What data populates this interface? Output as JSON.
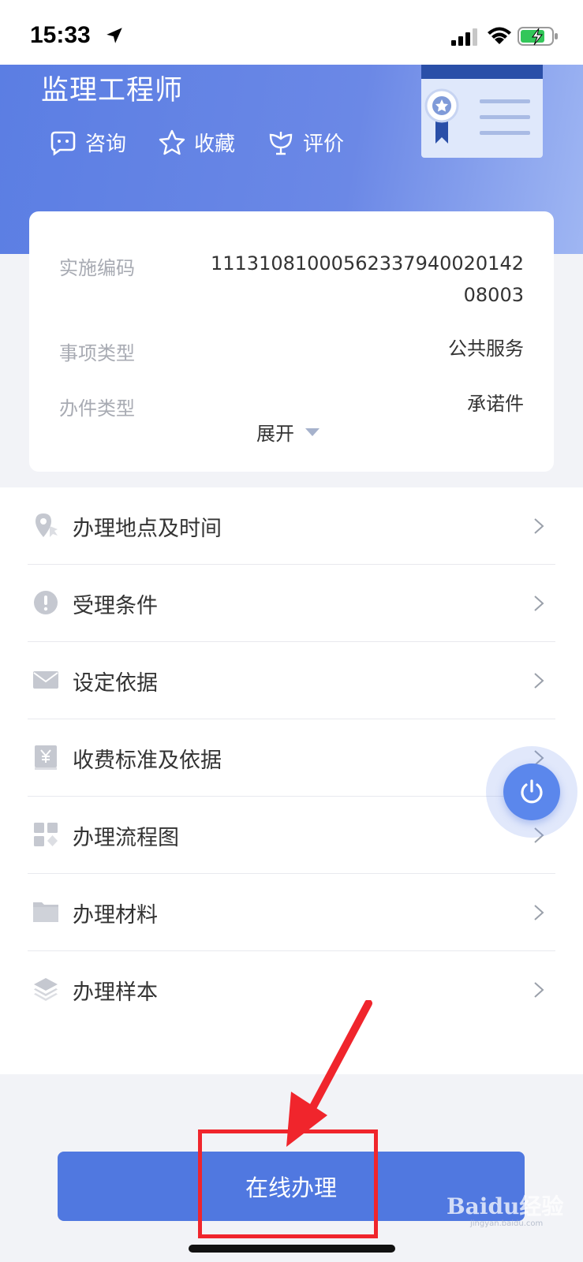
{
  "status_bar": {
    "time": "15:33"
  },
  "hero": {
    "title": "监理工程师",
    "actions": [
      {
        "label": "咨询",
        "icon": "chat-icon"
      },
      {
        "label": "收藏",
        "icon": "star-icon"
      },
      {
        "label": "评价",
        "icon": "rate-icon"
      }
    ]
  },
  "info": {
    "rows": [
      {
        "label": "实施编码",
        "value_line1": "11131081000562337940020142",
        "value_line2": "08003"
      },
      {
        "label": "事项类型",
        "value_line1": "公共服务"
      },
      {
        "label": "办件类型",
        "value_line1": "承诺件"
      }
    ],
    "expand_label": "展开"
  },
  "menu": {
    "items": [
      {
        "label": "办理地点及时间",
        "icon": "location-icon"
      },
      {
        "label": "受理条件",
        "icon": "alert-icon"
      },
      {
        "label": "设定依据",
        "icon": "mail-icon"
      },
      {
        "label": "收费标准及依据",
        "icon": "fee-icon"
      },
      {
        "label": "办理流程图",
        "icon": "flow-icon"
      },
      {
        "label": "办理材料",
        "icon": "folder-icon"
      },
      {
        "label": "办理样本",
        "icon": "layers-icon"
      }
    ]
  },
  "submit_label": "在线办理",
  "watermark": {
    "brand": "Baidu经验",
    "url": "jingyan.baidu.com"
  },
  "colors": {
    "primary": "#5078e0",
    "highlight": "#f0252c",
    "hero_start": "#5b7ee3"
  }
}
